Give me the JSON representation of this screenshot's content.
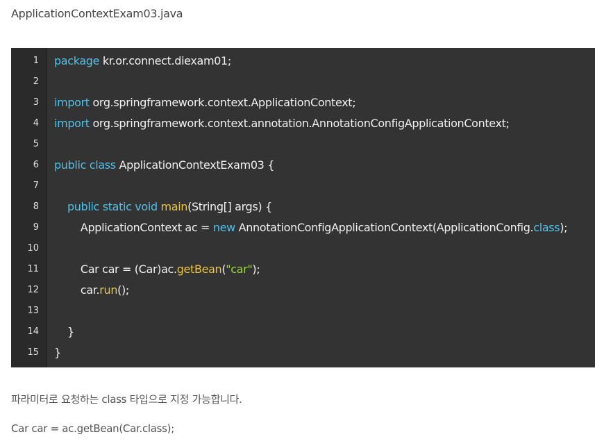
{
  "file_title": "ApplicationContextExam03.java",
  "code": {
    "lines": [
      {
        "num": "1",
        "tokens": [
          {
            "t": "package",
            "k": "kw"
          },
          {
            "t": " kr.or.connect.diexam01;",
            "k": "plain"
          }
        ]
      },
      {
        "num": "2",
        "tokens": []
      },
      {
        "num": "3",
        "tokens": [
          {
            "t": "import",
            "k": "kw"
          },
          {
            "t": " org.springframework.context.ApplicationContext;",
            "k": "plain"
          }
        ]
      },
      {
        "num": "4",
        "tokens": [
          {
            "t": "import",
            "k": "kw"
          },
          {
            "t": " org.springframework.context.annotation.AnnotationConfigApplicationContext;",
            "k": "plain"
          }
        ]
      },
      {
        "num": "5",
        "tokens": []
      },
      {
        "num": "6",
        "tokens": [
          {
            "t": "public class",
            "k": "kw"
          },
          {
            "t": " ApplicationContextExam03 {",
            "k": "plain"
          }
        ]
      },
      {
        "num": "7",
        "tokens": []
      },
      {
        "num": "8",
        "tokens": [
          {
            "t": "    ",
            "k": "plain"
          },
          {
            "t": "public static void",
            "k": "kw"
          },
          {
            "t": " ",
            "k": "plain"
          },
          {
            "t": "main",
            "k": "fn"
          },
          {
            "t": "(String[] args) {",
            "k": "plain"
          }
        ]
      },
      {
        "num": "9",
        "tokens": [
          {
            "t": "        ApplicationContext ac = ",
            "k": "plain"
          },
          {
            "t": "new",
            "k": "kw"
          },
          {
            "t": " AnnotationConfigApplicationContext(ApplicationConfig.",
            "k": "plain"
          },
          {
            "t": "class",
            "k": "kw"
          },
          {
            "t": ");",
            "k": "plain"
          }
        ]
      },
      {
        "num": "10",
        "tokens": []
      },
      {
        "num": "11",
        "tokens": [
          {
            "t": "        Car car = (Car)ac.",
            "k": "plain"
          },
          {
            "t": "getBean",
            "k": "fn"
          },
          {
            "t": "(",
            "k": "plain"
          },
          {
            "t": "\"car\"",
            "k": "str"
          },
          {
            "t": ");",
            "k": "plain"
          }
        ]
      },
      {
        "num": "12",
        "tokens": [
          {
            "t": "        car.",
            "k": "plain"
          },
          {
            "t": "run",
            "k": "fn"
          },
          {
            "t": "();",
            "k": "plain"
          }
        ]
      },
      {
        "num": "13",
        "tokens": []
      },
      {
        "num": "14",
        "tokens": [
          {
            "t": "    }",
            "k": "plain"
          }
        ]
      },
      {
        "num": "15",
        "tokens": [
          {
            "t": "}",
            "k": "plain"
          }
        ]
      }
    ]
  },
  "paragraphs": [
    "파라미터로 요청하는 class 타입으로 지정 가능합니다.",
    "Car car = ac.getBean(Car.class);"
  ]
}
